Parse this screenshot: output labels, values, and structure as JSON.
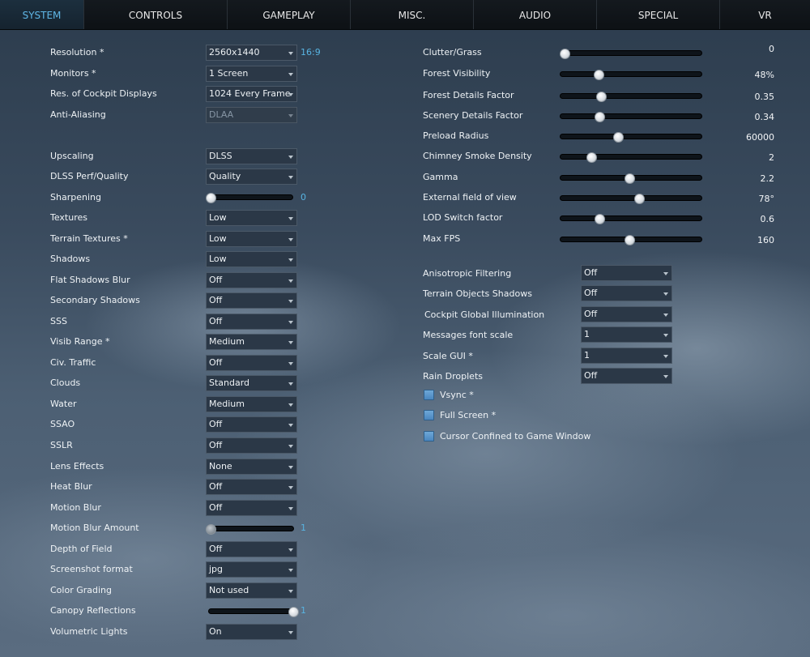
{
  "tabs": [
    "SYSTEM",
    "CONTROLS",
    "GAMEPLAY",
    "MISC.",
    "AUDIO",
    "SPECIAL",
    "VR"
  ],
  "left": {
    "resolution": {
      "label": "Resolution *",
      "value": "2560x1440",
      "ratio": "16:9"
    },
    "monitors": {
      "label": "Monitors *",
      "value": "1 Screen"
    },
    "cockpit_displays": {
      "label": "Res. of Cockpit Displays",
      "value": "1024 Every Frame"
    },
    "anti_aliasing": {
      "label": "Anti-Aliasing",
      "value": "DLAA"
    },
    "upscaling": {
      "label": "Upscaling",
      "value": "DLSS"
    },
    "dlss_quality": {
      "label": "DLSS Perf/Quality",
      "value": "Quality"
    },
    "sharpening": {
      "label": "Sharpening",
      "value": "0",
      "level": 0
    },
    "textures": {
      "label": "Textures",
      "value": "Low"
    },
    "terrain_textures": {
      "label": "Terrain Textures *",
      "value": "Low"
    },
    "shadows": {
      "label": "Shadows",
      "value": "Low"
    },
    "flat_shadows_blur": {
      "label": "Flat Shadows Blur",
      "value": "Off"
    },
    "secondary_shadows": {
      "label": "Secondary Shadows",
      "value": "Off"
    },
    "sss": {
      "label": "SSS",
      "value": "Off"
    },
    "visib_range": {
      "label": "Visib Range *",
      "value": "Medium"
    },
    "civ_traffic": {
      "label": "Civ. Traffic",
      "value": "Off"
    },
    "clouds": {
      "label": "Clouds",
      "value": "Standard"
    },
    "water": {
      "label": "Water",
      "value": "Medium"
    },
    "ssao": {
      "label": "SSAO",
      "value": "Off"
    },
    "sslr": {
      "label": "SSLR",
      "value": "Off"
    },
    "lens_effects": {
      "label": "Lens Effects",
      "value": "None"
    },
    "heat_blur": {
      "label": "Heat Blur",
      "value": "Off"
    },
    "motion_blur": {
      "label": "Motion Blur",
      "value": "Off"
    },
    "motion_blur_amount": {
      "label": "Motion Blur Amount",
      "value": "1",
      "level": 0
    },
    "depth_of_field": {
      "label": "Depth of Field",
      "value": "Off"
    },
    "screenshot_format": {
      "label": "Screenshot format",
      "value": "jpg"
    },
    "color_grading": {
      "label": "Color Grading",
      "value": "Not used"
    },
    "canopy_reflections": {
      "label": "Canopy Reflections",
      "value": "1",
      "level": 1
    },
    "volumetric_lights": {
      "label": "Volumetric Lights",
      "value": "On"
    }
  },
  "right": {
    "sliders": [
      {
        "label": "Clutter/Grass",
        "value": "0",
        "level": 0.02
      },
      {
        "label": "Forest Visibility",
        "value": "48%",
        "level": 0.26
      },
      {
        "label": "Forest Details Factor",
        "value": "0.35",
        "level": 0.28
      },
      {
        "label": "Scenery Details Factor",
        "value": "0.34",
        "level": 0.27
      },
      {
        "label": "Preload Radius",
        "value": "60000",
        "level": 0.4
      },
      {
        "label": "Chimney Smoke Density",
        "value": "2",
        "level": 0.21
      },
      {
        "label": "Gamma",
        "value": "2.2",
        "level": 0.48
      },
      {
        "label": "External field of view",
        "value": "78°",
        "level": 0.55
      },
      {
        "label": "LOD Switch factor",
        "value": "0.6",
        "level": 0.27
      },
      {
        "label": "Max FPS",
        "value": "160",
        "level": 0.48
      }
    ],
    "anisotropic": {
      "label": "Anisotropic Filtering",
      "value": "Off"
    },
    "terrain_objects_shadows": {
      "label": "Terrain Objects Shadows",
      "value": "Off"
    },
    "cockpit_gi": {
      "label": "Cockpit Global Illumination",
      "value": "Off"
    },
    "messages_font_scale": {
      "label": "Messages font scale",
      "value": "1"
    },
    "scale_gui": {
      "label": "Scale GUI *",
      "value": "1"
    },
    "rain_droplets": {
      "label": "Rain Droplets",
      "value": "Off"
    },
    "vsync": {
      "label": "Vsync *",
      "checked": true
    },
    "full_screen": {
      "label": "Full Screen *",
      "checked": true
    },
    "cursor_confined": {
      "label": "Cursor Confined to Game Window",
      "checked": true
    }
  }
}
